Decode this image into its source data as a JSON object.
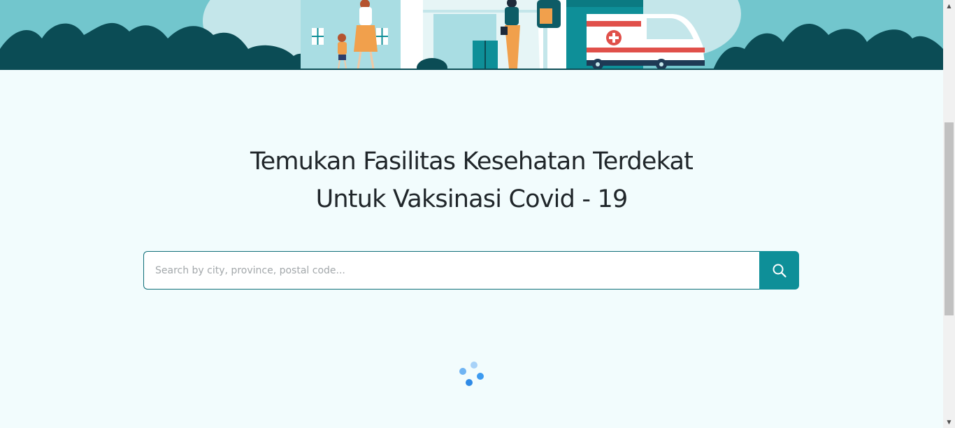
{
  "headline": {
    "line1": "Temukan Fasilitas Kesehatan Terdekat",
    "line2": "Untuk Vaksinasi Covid - 19"
  },
  "search": {
    "placeholder": "Search by city, province, postal code...",
    "value": ""
  },
  "icons": {
    "search": "search-icon",
    "loading": "loading-spinner-icon",
    "scroll_up": "chevron-up-icon",
    "scroll_down": "chevron-down-icon"
  },
  "colors": {
    "background": "#f2fcfd",
    "accent": "#0e8f98",
    "hero_sky": "#72c6cd",
    "hero_foliage": "#0b4c55",
    "spinner": "#3d9bf0",
    "heading_text": "#20262a"
  }
}
